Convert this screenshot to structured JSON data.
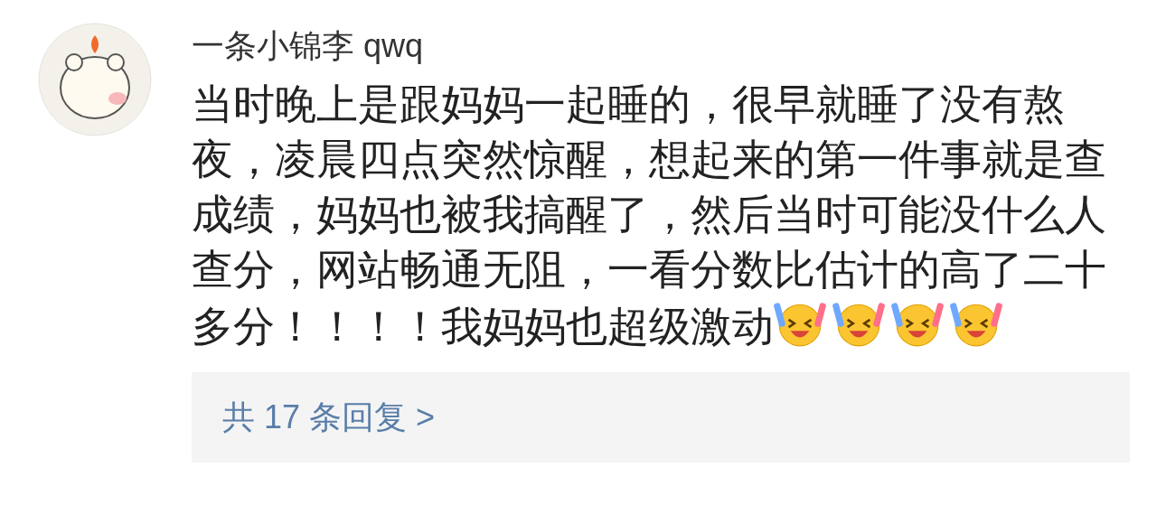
{
  "comment": {
    "author": "一条小锦李 qwq",
    "text": "当时晚上是跟妈妈一起睡的，很早就睡了没有熬夜，凌晨四点突然惊醒，想起来的第一件事就是查成绩，妈妈也被我搞醒了，然后当时可能没什么人查分，网站畅通无阻，一看分数比估计的高了二十多分！！！！我妈妈也超级激动",
    "emojis": [
      {
        "kind": "cheer"
      },
      {
        "kind": "cheer"
      },
      {
        "kind": "cheer"
      },
      {
        "kind": "cheer"
      }
    ],
    "replies_link": "共 17 条回复 >"
  }
}
